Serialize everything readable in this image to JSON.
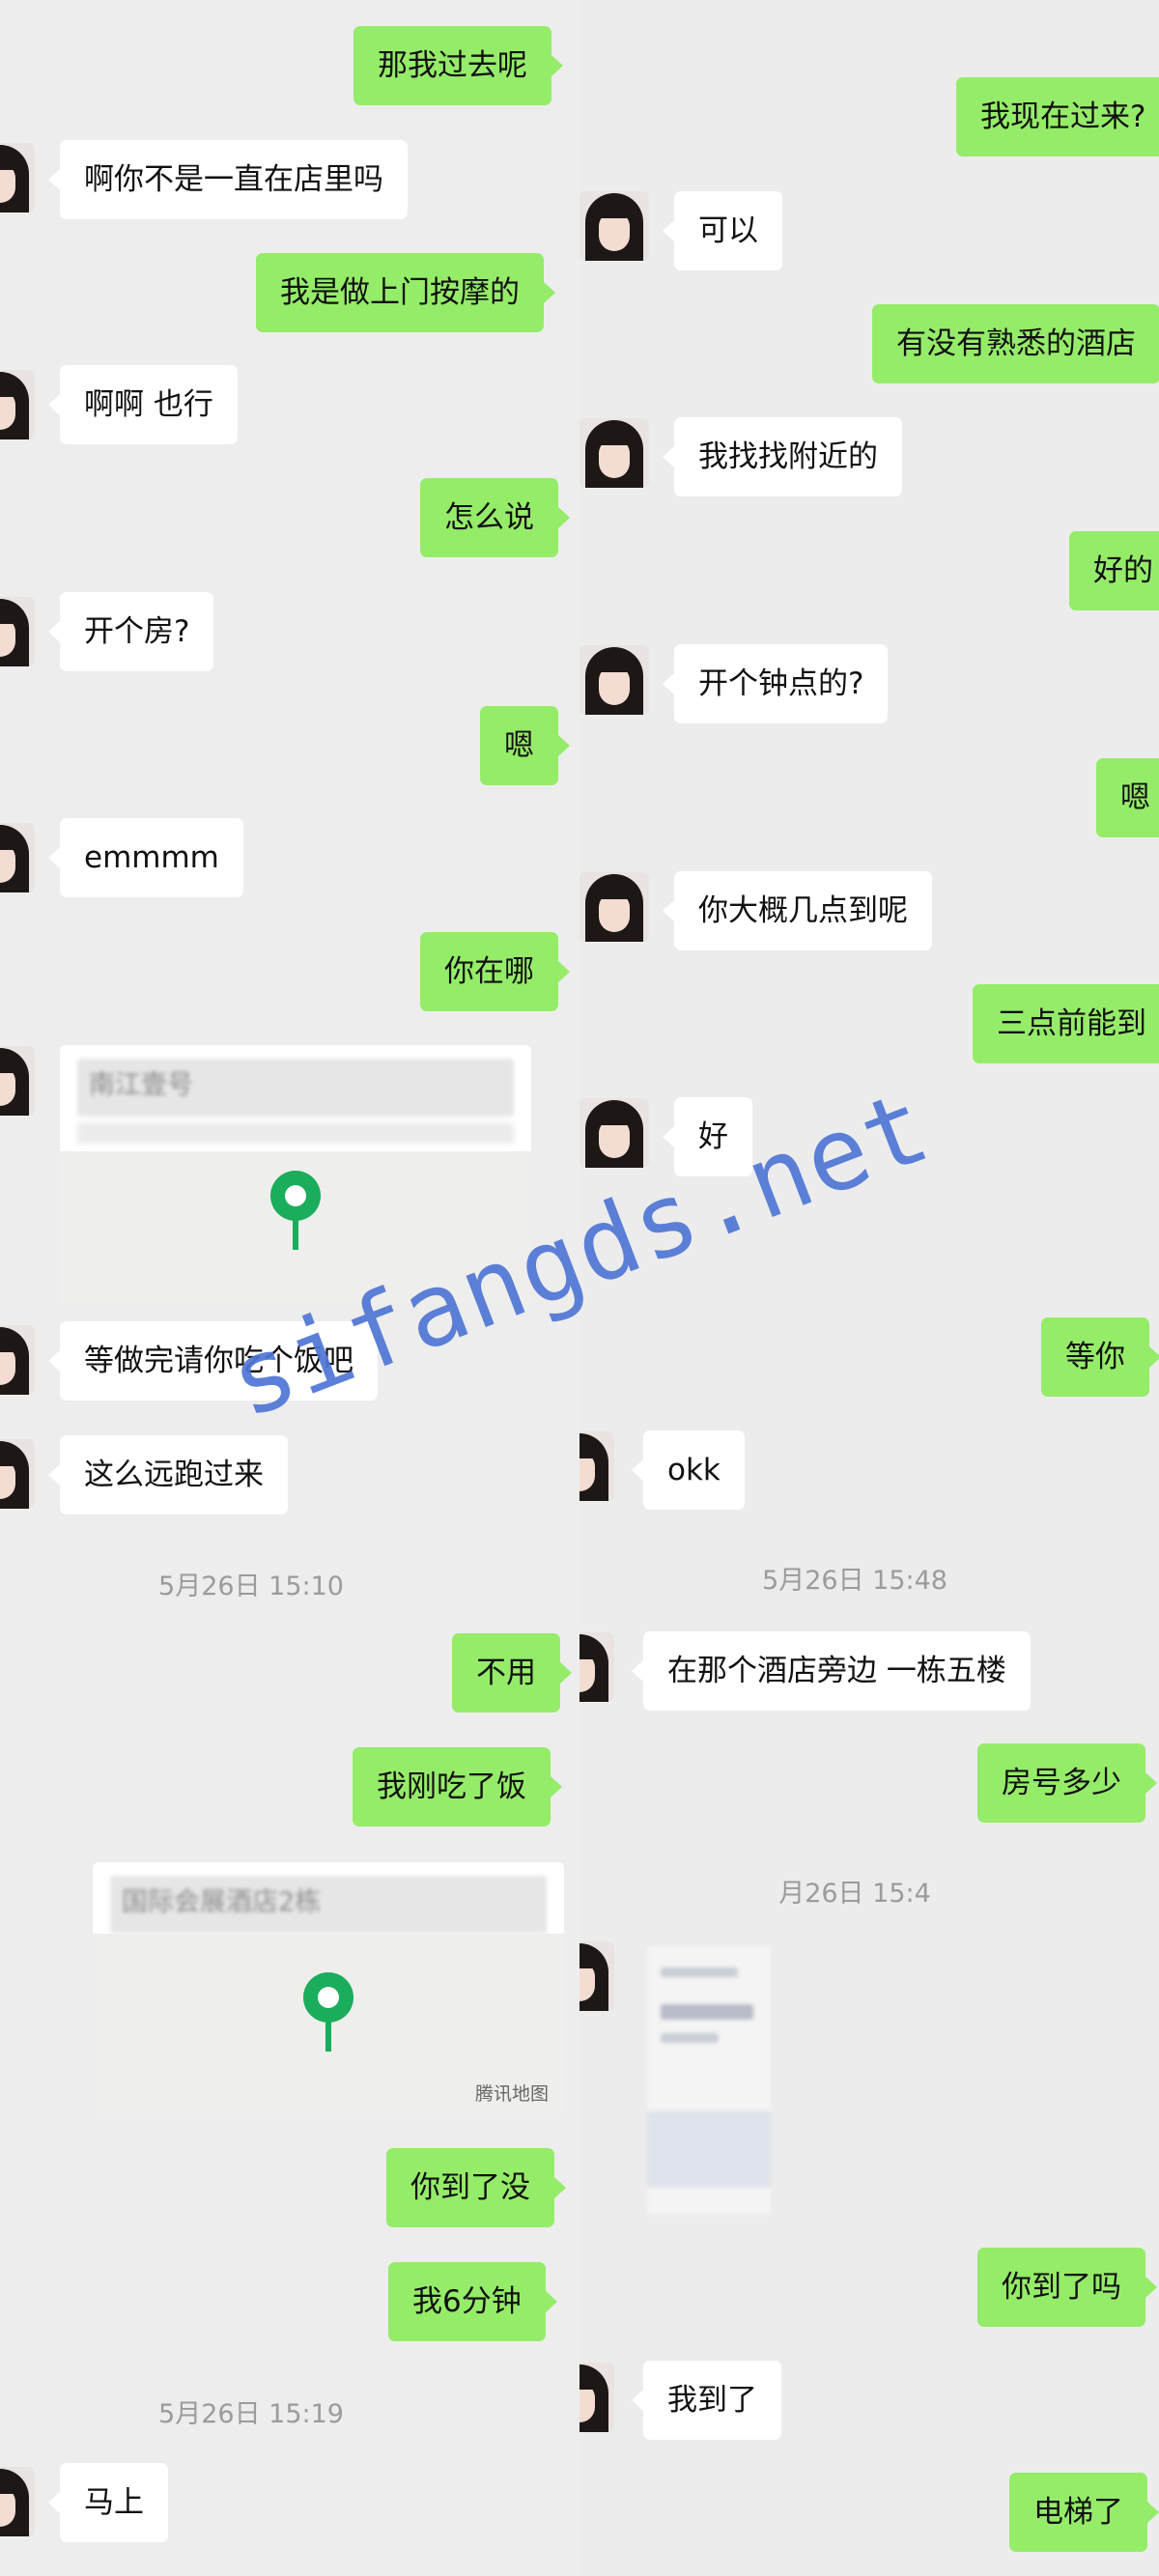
{
  "left_column": {
    "messages": [
      {
        "from": "me",
        "text": "那我过去呢"
      },
      {
        "from": "them",
        "text": "啊你不是一直在店里吗"
      },
      {
        "from": "me",
        "text": "我是做上门按摩的"
      },
      {
        "from": "them",
        "text": "啊啊 也行"
      },
      {
        "from": "me",
        "text": "怎么说"
      },
      {
        "from": "them",
        "text": "开个房?"
      },
      {
        "from": "me",
        "text": "嗯"
      },
      {
        "from": "them",
        "text": "emmmm"
      },
      {
        "from": "me",
        "text": "你在哪"
      },
      {
        "from": "them",
        "type": "map",
        "title": "南江壹号"
      },
      {
        "from": "them",
        "text": "等做完请你吃个饭吧"
      },
      {
        "from": "them",
        "text": "这么远跑过来"
      },
      {
        "type": "time",
        "text": "5月26日 15:10"
      },
      {
        "from": "me",
        "text": "不用"
      },
      {
        "from": "me",
        "text": "我刚吃了饭"
      },
      {
        "from": "me",
        "type": "map",
        "title": "国际会展酒店2栋",
        "credit": "腾讯地图"
      },
      {
        "from": "me",
        "text": "你到了没"
      },
      {
        "from": "me",
        "text": "我6分钟"
      },
      {
        "type": "time",
        "text": "5月26日 15:19"
      },
      {
        "from": "them",
        "text": "马上"
      }
    ]
  },
  "right_column": {
    "messages": [
      {
        "from": "me",
        "text": "我现在过来?"
      },
      {
        "from": "them",
        "text": "可以"
      },
      {
        "from": "me",
        "text": "有没有熟悉的酒店"
      },
      {
        "from": "them",
        "text": "我找找附近的"
      },
      {
        "from": "me",
        "text": "好的"
      },
      {
        "from": "them",
        "text": "开个钟点的?"
      },
      {
        "from": "me",
        "text": "嗯"
      },
      {
        "from": "them",
        "text": "你大概几点到呢"
      },
      {
        "from": "me",
        "text": "三点前能到"
      },
      {
        "from": "them",
        "text": "好"
      },
      {
        "from": "me",
        "text": "等你"
      },
      {
        "from": "them",
        "text": "okk"
      },
      {
        "type": "time",
        "text": "5月26日 15:48"
      },
      {
        "from": "them",
        "text": "在那个酒店旁边 一栋五楼"
      },
      {
        "from": "me",
        "text": "房号多少"
      },
      {
        "type": "time",
        "text": "月26日 15:4"
      },
      {
        "from": "them",
        "type": "image"
      },
      {
        "from": "me",
        "text": "你到了吗"
      },
      {
        "from": "them",
        "text": "我到了"
      },
      {
        "from": "me",
        "text": "电梯了"
      }
    ]
  },
  "watermark": "sifangds.net",
  "colors": {
    "me_bubble": "#95ec69",
    "them_bubble": "#ffffff",
    "background": "#ededed",
    "watermark": "#4f76d6",
    "map_pin": "#1aad5b"
  }
}
